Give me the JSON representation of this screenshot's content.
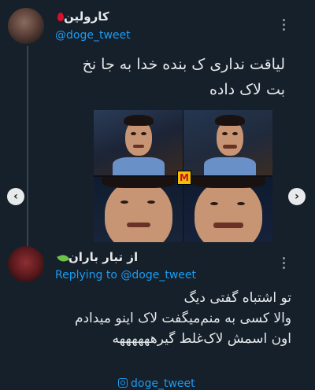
{
  "tweet": {
    "author_name": "کارولین",
    "author_emoji": "drop-of-blood-icon",
    "handle": "@doge_tweet",
    "text_line1": "لیاقت نداری ک بنده خدا به جا نخ",
    "text_line2": "بت لاک داده",
    "media_badge": "M"
  },
  "reply": {
    "author_name": "از تبار باران",
    "author_emoji": "leaf-icon",
    "replying_to": "Replying to @doge_tweet",
    "text_line1": "تو اشتباه گفتی دیگ",
    "text_line2": "والا کسی به منم‌میگفت لاک اینو میدادم",
    "text_line3": "اون اسمش لاک‌غلط گیرههههههه"
  },
  "carousel": {
    "prev_icon": "chevron-left-icon",
    "next_icon": "chevron-right-icon"
  },
  "watermark": {
    "icon": "instagram-icon",
    "text": "doge_tweet"
  },
  "colors": {
    "background": "#15202b",
    "accent": "#1d9bf0",
    "text": "#e7e9ea"
  }
}
